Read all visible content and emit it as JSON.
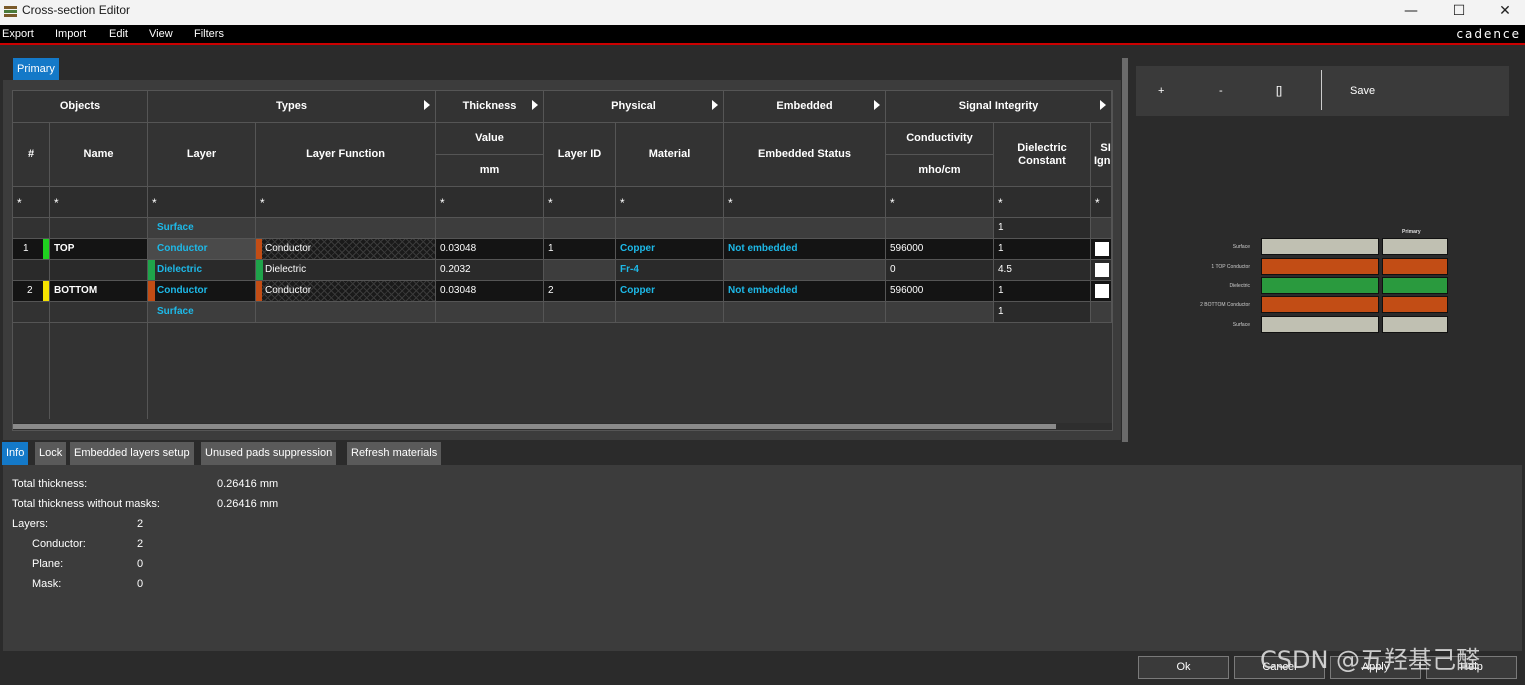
{
  "window": {
    "title": "Cross-section Editor",
    "min": "—",
    "max": "☐",
    "close": "✕"
  },
  "menu": {
    "items": [
      "Export",
      "Import",
      "Edit",
      "View",
      "Filters"
    ],
    "brand": "cadence"
  },
  "tabs": {
    "primary": "Primary"
  },
  "table": {
    "group_headers": [
      "Objects",
      "Types",
      "Thickness",
      "Physical",
      "Embedded",
      "Signal Integrity"
    ],
    "col_headers": {
      "num": "#",
      "name": "Name",
      "layer": "Layer",
      "layer_function": "Layer Function",
      "value": "Value",
      "unit": "mm",
      "layer_id": "Layer ID",
      "material": "Material",
      "embedded_status": "Embedded Status",
      "conductivity": "Conductivity",
      "conductivity_unit": "mho/cm",
      "dielectric_constant": "Dielectric Constant",
      "si": "SI Igno"
    },
    "filter": "*",
    "rows": [
      {
        "num": "",
        "name": "",
        "layer": "Surface",
        "layer_function": "",
        "value": "",
        "layer_id": "",
        "material": "",
        "embedded": "",
        "conductivity": "",
        "dk": "1",
        "color": ""
      },
      {
        "num": "1",
        "name": "TOP",
        "layer": "Conductor",
        "layer_function": "Conductor",
        "value": "0.03048",
        "layer_id": "1",
        "material": "Copper",
        "embedded": "Not embedded",
        "conductivity": "596000",
        "dk": "1",
        "color": "#1fd01f"
      },
      {
        "num": "",
        "name": "",
        "layer": "Dielectric",
        "layer_function": "Dielectric",
        "value": "0.2032",
        "layer_id": "",
        "material": "Fr-4",
        "embedded": "",
        "conductivity": "0",
        "dk": "4.5",
        "color": "#1fa34a"
      },
      {
        "num": "2",
        "name": "BOTTOM",
        "layer": "Conductor",
        "layer_function": "Conductor",
        "value": "0.03048",
        "layer_id": "2",
        "material": "Copper",
        "embedded": "Not embedded",
        "conductivity": "596000",
        "dk": "1",
        "color": "#f5e200"
      },
      {
        "num": "",
        "name": "",
        "layer": "Surface",
        "layer_function": "",
        "value": "",
        "layer_id": "",
        "material": "",
        "embedded": "",
        "conductivity": "",
        "dk": "1",
        "color": ""
      }
    ]
  },
  "right_panel": {
    "toolbar": {
      "add": "+",
      "remove": "-",
      "brackets": "[]",
      "save": "Save"
    },
    "stack_header": "Primary",
    "stack": [
      {
        "label": "Surface",
        "color": "#c0c0b2"
      },
      {
        "label": "1   TOP Conductor",
        "color": "#c24d15"
      },
      {
        "label": "Dielectric",
        "color": "#2a9a3e"
      },
      {
        "label": "2   BOTTOM Conductor",
        "color": "#c24d15"
      },
      {
        "label": "Surface",
        "color": "#c0c0b2"
      }
    ]
  },
  "bottom_tabs": [
    "Info",
    "Lock",
    "Embedded layers setup",
    "Unused pads suppression",
    "Refresh materials"
  ],
  "info": {
    "total_thickness_label": "Total thickness:",
    "total_thickness": "0.26416 mm",
    "total_without_masks_label": "Total thickness without masks:",
    "total_without_masks": "0.26416 mm",
    "layers_label": "Layers:",
    "layers": "2",
    "conductor_label": "Conductor:",
    "conductor": "2",
    "plane_label": "Plane:",
    "plane": "0",
    "mask_label": "Mask:",
    "mask": "0"
  },
  "dialog": {
    "ok": "Ok",
    "cancel": "Cancel",
    "apply": "Apply",
    "help": "Help"
  },
  "watermark": "CSDN @五羟基己醛"
}
